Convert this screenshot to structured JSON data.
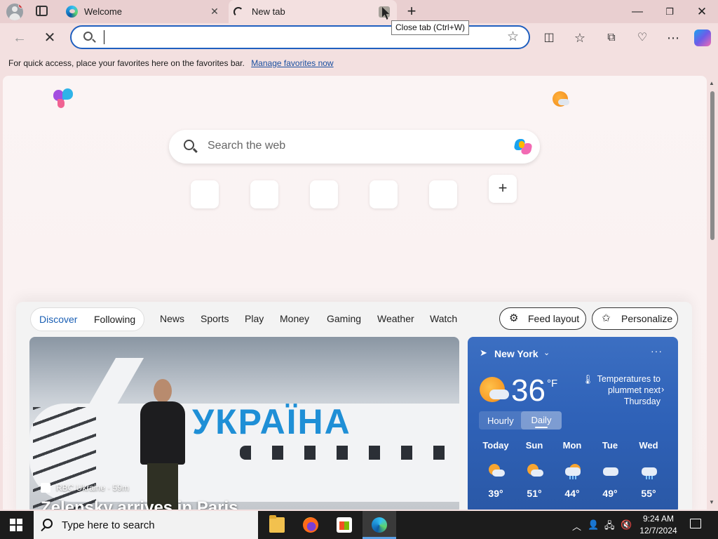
{
  "browser": {
    "tabs": [
      {
        "title": "Welcome"
      },
      {
        "title": "New tab"
      }
    ],
    "tooltip": "Close tab (Ctrl+W)",
    "omnibox": {
      "value": "",
      "placeholder": ""
    },
    "favorites_bar": {
      "message": "For quick access, place your favorites here on the favorites bar.",
      "link": "Manage favorites now"
    },
    "icons": [
      "profile-icon",
      "tab-actions-icon",
      "close-icon",
      "add-icon",
      "minimize-icon",
      "restore-icon",
      "back-icon",
      "stop-icon",
      "search-icon",
      "star-icon",
      "split-screen-icon",
      "favorites-icon",
      "collections-icon",
      "browser-essentials-icon",
      "more-icon",
      "copilot-icon"
    ]
  },
  "newtab": {
    "search_placeholder": "Search the web",
    "quick_links_count": 5,
    "feed": {
      "tabs": [
        {
          "label": "Discover",
          "active": true
        },
        {
          "label": "Following",
          "active": false
        }
      ],
      "nav": [
        "News",
        "Sports",
        "Play",
        "Money",
        "Gaming",
        "Weather",
        "Watch"
      ],
      "feed_layout_label": "Feed layout",
      "personalize_label": "Personalize",
      "accent": "#1a5fb4"
    },
    "hero": {
      "source": "RBC Ukraine",
      "age": "59m",
      "source_line": "RBC Ukraine · 59m",
      "headline": "Zelensky arrives in Paris",
      "image_text": "УКРАЇНА"
    },
    "weather": {
      "location": "New York",
      "temperature": "36",
      "unit": "°F",
      "alert": "Temperatures to plummet next Thursday",
      "toggle": [
        "Hourly",
        "Daily"
      ],
      "toggle_selected": "Daily",
      "forecast": [
        {
          "day": "Today",
          "temp": "39°",
          "icon": "partly-sunny-icon"
        },
        {
          "day": "Sun",
          "temp": "51°",
          "icon": "partly-sunny-icon"
        },
        {
          "day": "Mon",
          "temp": "44°",
          "icon": "sun-cloud-rain-icon"
        },
        {
          "day": "Tue",
          "temp": "49°",
          "icon": "cloudy-icon"
        },
        {
          "day": "Wed",
          "temp": "55°",
          "icon": "rain-icon"
        }
      ]
    }
  },
  "taskbar": {
    "search_placeholder": "Type here to search",
    "apps": [
      "file-explorer-icon",
      "firefox-icon",
      "microsoft-store-icon",
      "edge-icon"
    ],
    "time": "9:24 AM",
    "date": "12/7/2024"
  }
}
